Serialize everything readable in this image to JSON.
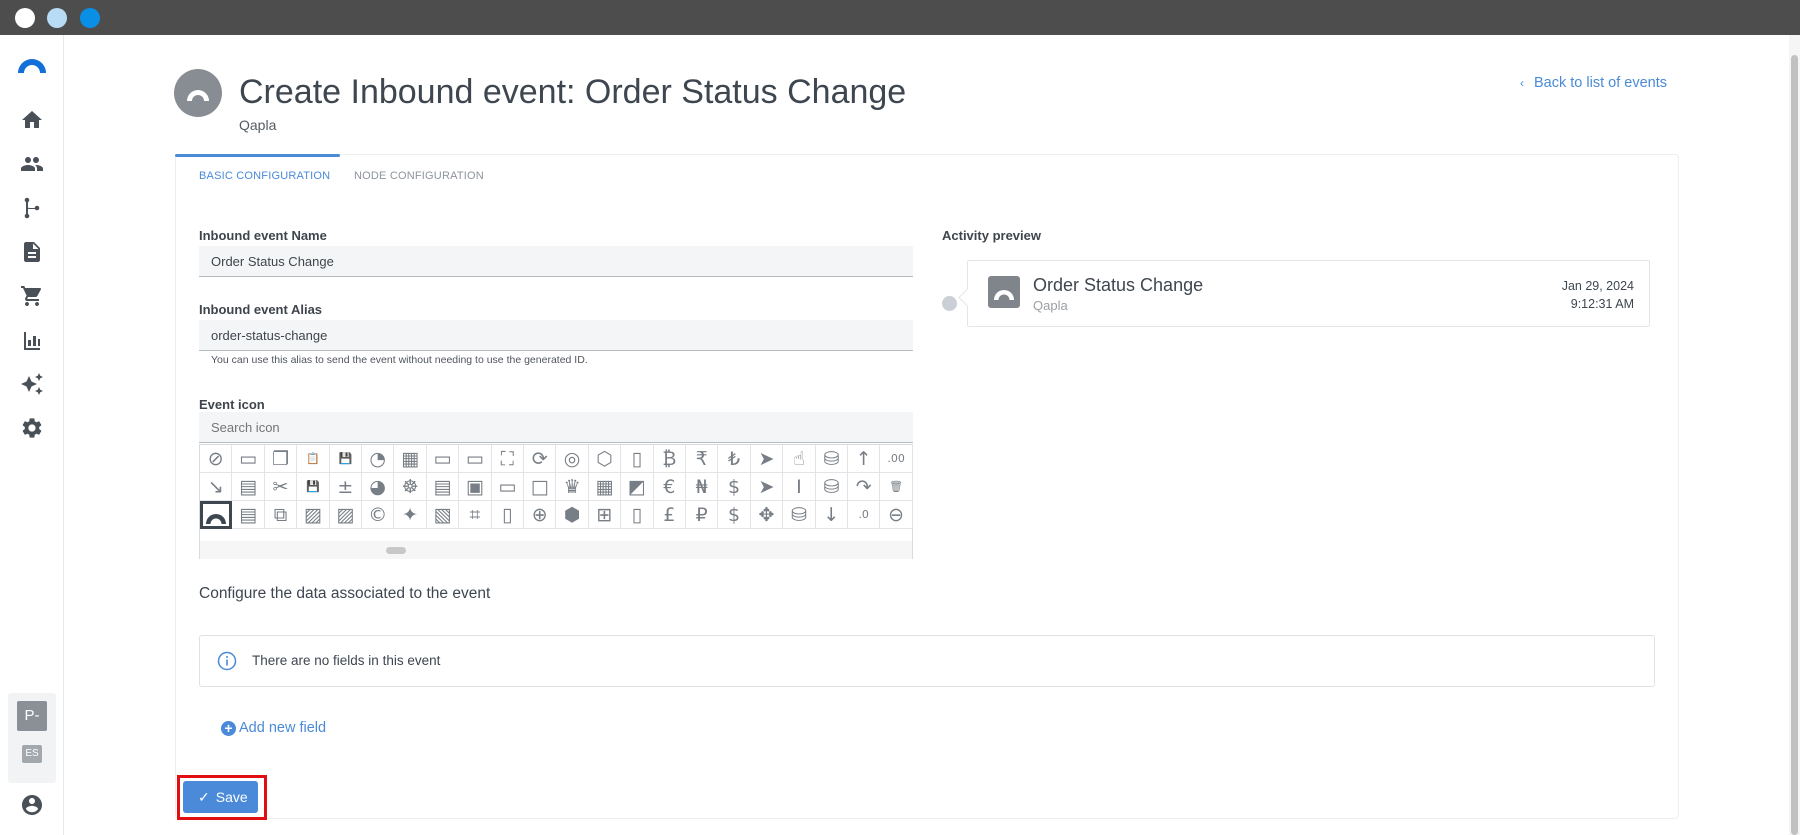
{
  "window": {
    "controls": [
      "close-dot",
      "minimize-dot",
      "maximize-dot"
    ]
  },
  "sidebar": {
    "items": [
      {
        "icon": "home-icon"
      },
      {
        "icon": "people-icon"
      },
      {
        "icon": "branch-icon"
      },
      {
        "icon": "document-icon"
      },
      {
        "icon": "cart-icon"
      },
      {
        "icon": "bar-chart-icon"
      },
      {
        "icon": "sparkles-icon"
      },
      {
        "icon": "gear-icon"
      }
    ],
    "user_initial": "P-",
    "user_lang": "ES"
  },
  "header": {
    "title": "Create Inbound event: Order Status Change",
    "subtitle": "Qapla",
    "back_link": "Back to list of events"
  },
  "tabs": [
    {
      "label": "BASIC CONFIGURATION",
      "active": true
    },
    {
      "label": "NODE CONFIGURATION",
      "active": false
    }
  ],
  "form": {
    "name_label": "Inbound event Name",
    "name_value": "Order Status Change",
    "alias_label": "Inbound event Alias",
    "alias_value": "order-status-change",
    "alias_hint": "You can use this alias to send the event without needing to use the generated ID.",
    "icon_label": "Event icon",
    "icon_search_placeholder": "Search icon"
  },
  "icon_grid": {
    "rows": [
      [
        "⊘",
        "▭",
        "❐",
        "📋",
        "💾",
        "◔",
        "▦",
        "▭",
        "▭",
        "⛶",
        "⟳",
        "◎",
        "⬡",
        "▯",
        "₿",
        "₹",
        "₺",
        "➤",
        "☝",
        "⛁",
        "↑",
        ".00"
      ],
      [
        "↘",
        "▤",
        "✂",
        "💾",
        "±",
        "◕",
        "☸",
        "▤",
        "▣",
        "▭",
        "□",
        "♛",
        "▦",
        "◩",
        "€",
        "₦",
        "$",
        "➤",
        "I",
        "⛁",
        "↷",
        "🗑"
      ],
      [
        "◠",
        "▤",
        "⧉",
        "▨",
        "▨",
        "©",
        "✦",
        "▧",
        "⌗",
        "▯",
        "⊕",
        "⬢",
        "⊞",
        "▯",
        "£",
        "₽",
        "$",
        "✥",
        "⛁",
        "↓",
        ".0",
        "⊖"
      ]
    ],
    "selected": [
      2,
      0
    ]
  },
  "preview": {
    "label": "Activity preview",
    "title": "Order Status Change",
    "subtitle": "Qapla",
    "date": "Jan 29, 2024",
    "time": "9:12:31 AM"
  },
  "data_section": {
    "title": "Configure the data associated to the event",
    "empty_text": "There are no fields in this event",
    "add_field": "Add new field"
  },
  "save_label": "Save",
  "colors": {
    "accent": "#4a8ad8",
    "highlight": "#e10f12"
  }
}
